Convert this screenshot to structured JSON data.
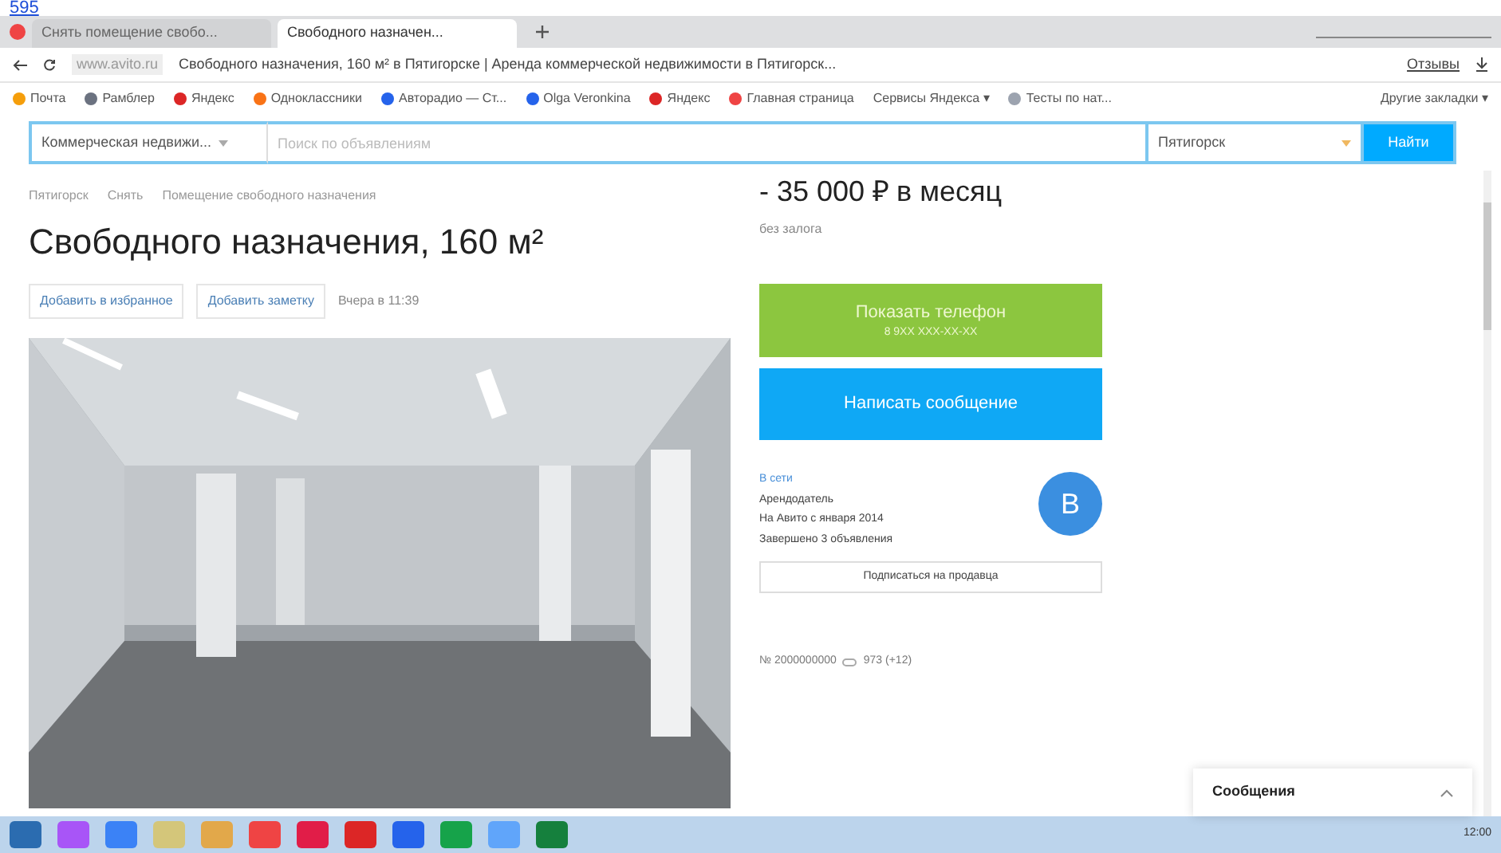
{
  "top_link": "595",
  "browser": {
    "tabs": [
      {
        "title": "Снять помещение свобо...",
        "selected": false
      },
      {
        "title": "Свободного назначен...",
        "selected": true
      }
    ],
    "url": "www.avito.ru",
    "page_title": "Свободного назначения, 160 м² в Пятигорске | Аренда коммерческой недвижимости в Пятигорск...",
    "reviews": "Отзывы",
    "bookmarks": [
      {
        "label": "Почта",
        "color": "#f59e0b"
      },
      {
        "label": "Рамблер",
        "color": "#6b7280"
      },
      {
        "label": "Яндекс",
        "color": "#dc2626"
      },
      {
        "label": "Одноклассники",
        "color": "#f97316"
      },
      {
        "label": "Авторадио — Ст...",
        "color": "#2563eb"
      },
      {
        "label": "Olga Veronkina",
        "color": "#2563eb"
      },
      {
        "label": "Яндекс",
        "color": "#dc2626"
      },
      {
        "label": "Главная страница",
        "color": "#ef4444"
      },
      {
        "label": "Сервисы Яндекса ▾"
      },
      {
        "label": "Тесты по нат...",
        "color": "#9ca3af"
      }
    ],
    "other_bookmarks": "Другие закладки ▾"
  },
  "search": {
    "category": "Коммерческая недвижи...",
    "placeholder": "Поиск по объявлениям",
    "city": "Пятигорск",
    "button": "Найти"
  },
  "breadcrumbs": [
    "Пятигорск",
    "Снять",
    "Помещение свободного назначения"
  ],
  "title": "Свободного назначения, 160 м²",
  "actions": [
    "Добавить в избранное",
    "Добавить заметку"
  ],
  "posted": "Вчера в 11:39",
  "price": "- 35 000 ₽ в месяц",
  "deposit": "без залога",
  "phone_button": {
    "label": "Показать телефон",
    "number": "8 9ХХ ХХХ-ХХ-ХХ"
  },
  "message_button": "Написать сообщение",
  "seller": {
    "status": "В сети",
    "role": "Арендодатель",
    "since": "На Авито с января 2014",
    "completed": "Завершено 3 объявления",
    "avatar": "В",
    "subscribe": "Подписаться на продавца"
  },
  "listing_number": "№ 2000000000",
  "views": "973 (+12)",
  "messages_panel": "Сообщения",
  "taskbar": {
    "clock": "12:00"
  }
}
